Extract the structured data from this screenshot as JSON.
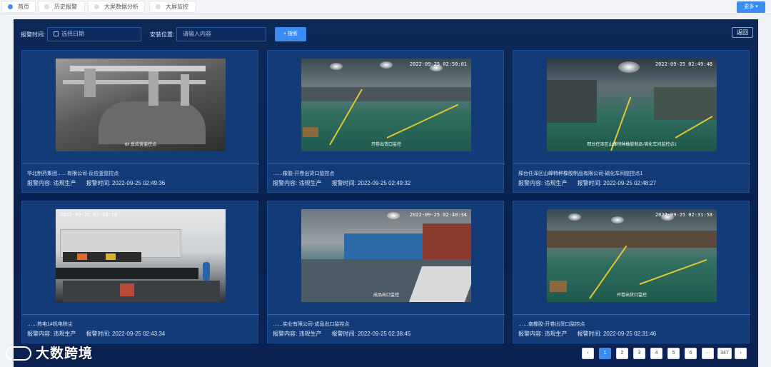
{
  "tabs": [
    {
      "label": "首页",
      "active": true
    },
    {
      "label": "历史报警",
      "active": false
    },
    {
      "label": "大屏数据分析",
      "active": false
    },
    {
      "label": "大屏监控",
      "active": false
    }
  ],
  "more_button": "更多",
  "filters": {
    "alarm_time_label": "报警时间:",
    "date_placeholder": "选择日期",
    "location_label": "安装位置:",
    "location_placeholder": "请输入内容",
    "search_button": "搜索",
    "back_button": "返回"
  },
  "labels": {
    "content": "报警内容:",
    "time": "报警时间:"
  },
  "cards": [
    {
      "title": "华北制药集团……有限公司-反应釜监控点",
      "content": "违规生产",
      "time": "2022-09-25 02:49:36",
      "overlay_time": "",
      "overlay_caption": "6# 反应釜监控点"
    },
    {
      "title": "……橡胶-开卷出货口监控点",
      "content": "违规生产",
      "time": "2022-09-25 02:49:32",
      "overlay_time": "2022-09-25 02:50:01",
      "overlay_caption": "开卷出货口监控"
    },
    {
      "title": "邢台任泽区山峰特种橡胶制品有限公司-硫化车间监控点1",
      "content": "违规生产",
      "time": "2022-09-25 02:48:27",
      "overlay_time": "2022-09-25 02:49:48",
      "overlay_caption": "邢台任泽区山峰特种橡胶制品-硫化车间监控点1"
    },
    {
      "title": "……热电1#机电除尘",
      "content": "违规生产",
      "time": "2022-09-25 02:43:34",
      "overlay_time": "2022-09-25 02:48:18",
      "overlay_caption": ""
    },
    {
      "title": "……实业有限公司-成品出口监控点",
      "content": "违规生产",
      "time": "2022-09-25 02:38:45",
      "overlay_time": "2022-09-25 02:40:34",
      "overlay_caption": "成品出口监控"
    },
    {
      "title": "……南橡胶-开卷出货口监控点",
      "content": "违规生产",
      "time": "2022-09-25 02:31:46",
      "overlay_time": "2022-09-25 02:31:58",
      "overlay_caption": "开卷出货口监控"
    }
  ],
  "pagination": {
    "prev": "‹",
    "pages": [
      "1",
      "2",
      "3",
      "4",
      "5",
      "6"
    ],
    "current": "1",
    "ellipsis": "···",
    "last": "347",
    "next": "›"
  },
  "watermark": "大数跨境"
}
